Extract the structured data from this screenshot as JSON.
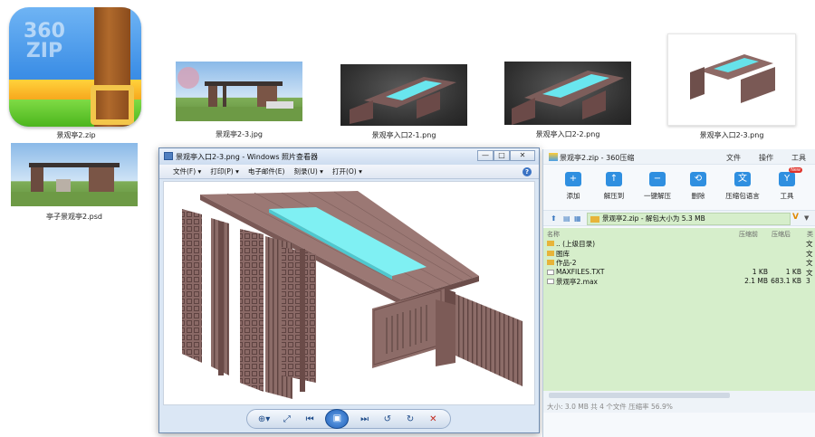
{
  "desktop": {
    "files": [
      {
        "id": "zip",
        "label": "景观亭2.zip"
      },
      {
        "id": "img1",
        "label": "景观亭2-3.jpg"
      },
      {
        "id": "img2",
        "label": "景观亭入口2-1.png"
      },
      {
        "id": "img3",
        "label": "景观亭入口2-2.png"
      },
      {
        "id": "img4",
        "label": "景观亭入口2-3.png"
      },
      {
        "id": "psd",
        "label": "亭子景观亭2.psd"
      }
    ],
    "zip_icon_text": "360\nZIP"
  },
  "viewer": {
    "title": "景观亭入口2-3.png - Windows 照片查看器",
    "window_buttons": [
      "—",
      "□",
      "✕"
    ],
    "menus": [
      "文件(F) ▾",
      "打印(P) ▾",
      "电子邮件(E)",
      "刻录(U) ▾",
      "打开(O) ▾"
    ],
    "help": "?",
    "controls": [
      "⊕▾",
      "⤢",
      "⏮",
      "▣",
      "⏭",
      "↺",
      "↻",
      "✕"
    ]
  },
  "zip": {
    "title": "景观亭2.zip - 360压缩",
    "menus": [
      "文件",
      "操作",
      "工具"
    ],
    "tools": [
      {
        "label": "添加",
        "icon": "+"
      },
      {
        "label": "解压到",
        "icon": "↑"
      },
      {
        "label": "一键解压",
        "icon": "−"
      },
      {
        "label": "删除",
        "icon": "⟲"
      },
      {
        "label": "压缩包语言",
        "icon": "文"
      },
      {
        "label": "工具",
        "icon": "Y"
      }
    ],
    "new_badge": "New",
    "path_text": "景观亭2.zip - 解包大小为 5.3 MB",
    "path_mark": "V",
    "path_drop": "▼",
    "columns": {
      "name": "名称",
      "size": "压缩前",
      "packed": "压缩后",
      "type": "类"
    },
    "rows": [
      {
        "name": ".. (上级目录)",
        "size": "",
        "packed": "",
        "type": "文",
        "kind": "folder"
      },
      {
        "name": "图库",
        "size": "",
        "packed": "",
        "type": "文",
        "kind": "folder"
      },
      {
        "name": "作品-2",
        "size": "",
        "packed": "",
        "type": "文",
        "kind": "folder"
      },
      {
        "name": "MAXFILES.TXT",
        "size": "1 KB",
        "packed": "1 KB",
        "type": "文",
        "kind": "file"
      },
      {
        "name": "景观亭2.max",
        "size": "2.1 MB",
        "packed": "683.1 KB",
        "type": "3",
        "kind": "file"
      }
    ],
    "status": "大小: 3.0 MB 共 4 个文件 压缩率 56.9%"
  }
}
